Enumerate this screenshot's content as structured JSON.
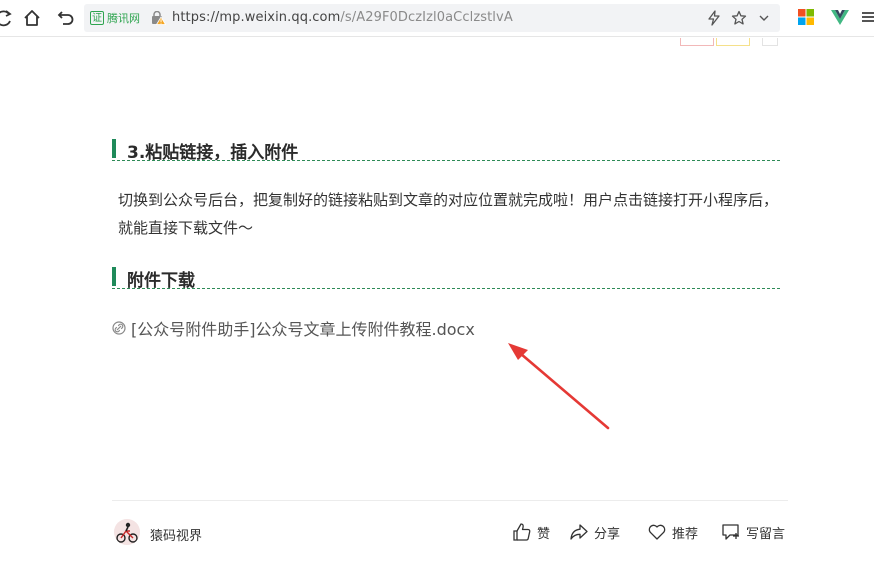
{
  "browser": {
    "cert_badge_text": "证",
    "cert_label": "腾讯网",
    "url_host": "https://mp.weixin.qq.com",
    "url_path": "/s/A29F0DczIzl0aCclzstlvA"
  },
  "article": {
    "section_heading": "3.粘贴链接，插入附件",
    "paragraph": "切换到公众号后台，把复制好的链接粘贴到文章的对应位置就完成啦！用户点击链接打开小程序后，就能直接下载文件～",
    "attachment_heading": "附件下载",
    "attachment_link": "[公众号附件助手]公众号文章上传附件教程.docx"
  },
  "footer": {
    "author": "猿码视界",
    "like_label": "赞",
    "share_label": "分享",
    "recommend_label": "推荐",
    "comment_label": "写留言"
  },
  "colors": {
    "accent_green": "#1f8a5a",
    "arrow_red": "#e53935"
  }
}
